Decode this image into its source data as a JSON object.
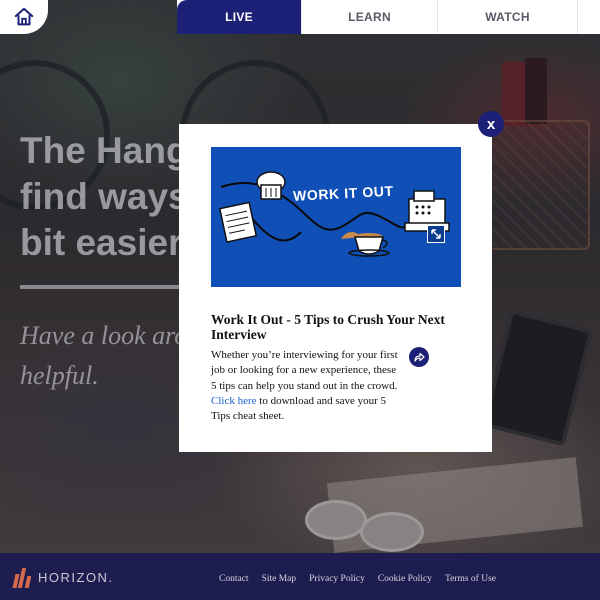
{
  "nav": {
    "tabs": [
      {
        "label": "LIVE",
        "active": true
      },
      {
        "label": "LEARN",
        "active": false
      },
      {
        "label": "WATCH",
        "active": false
      }
    ]
  },
  "hero": {
    "headline_lines": [
      "The Hango",
      "find ways t",
      "bit easier"
    ],
    "tagline_lines": [
      "Have a look aro",
      "helpful."
    ]
  },
  "modal": {
    "banner_text": "WORK IT OUT",
    "title": "Work It Out - 5 Tips to Crush Your Next Interview",
    "body_text": "Whether you’re interviewing for your first job or looking for a new experience, these 5 tips can help you stand out in the crowd. ",
    "link_text": "Click here",
    "body_tail": " to download and save your 5 Tips cheat sheet.",
    "close_glyph": "x",
    "icons": {
      "close": "close-icon",
      "share": "share-icon",
      "expand": "expand-icon"
    }
  },
  "footer": {
    "brand": "HORIZON.",
    "links": [
      "Contact",
      "Site Map",
      "Privacy Policy",
      "Cookie Policy",
      "Terms of Use"
    ]
  },
  "colors": {
    "navy": "#1c2076",
    "footer_bg": "#1d1d50",
    "banner_blue": "#0f4fb6",
    "logo_accent": "#d46a4a",
    "link_blue": "#1a5fc8"
  }
}
